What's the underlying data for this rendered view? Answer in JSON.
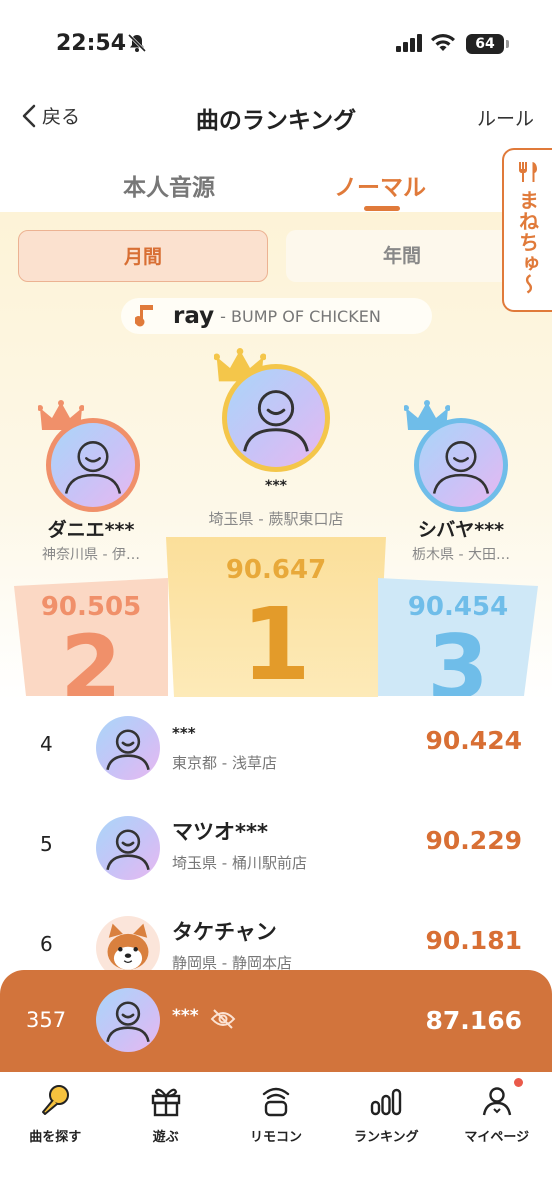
{
  "status": {
    "time": "22:54",
    "battery": "64"
  },
  "header": {
    "back_label": "戻る",
    "title": "曲のランキング",
    "rule_label": "ルール"
  },
  "tabs": {
    "honnin": "本人音源",
    "normal": "ノーマル"
  },
  "side_tab": {
    "label": "まねちゅ〜"
  },
  "period": {
    "month": "月間",
    "year": "年間"
  },
  "song": {
    "title": "ray",
    "artist": "- BUMP OF CHICKEN"
  },
  "podium": {
    "first": {
      "name": "***",
      "location": "埼玉県 - 蕨駅東口店",
      "score": "90.647",
      "rank": "1"
    },
    "second": {
      "name": "ダニエ***",
      "location": "神奈川県 - 伊…",
      "score": "90.505",
      "rank": "2"
    },
    "third": {
      "name": "シバヤ***",
      "location": "栃木県 - 大田…",
      "score": "90.454",
      "rank": "3"
    }
  },
  "list": [
    {
      "rank": "4",
      "name": "***",
      "location": "東京都 - 浅草店",
      "score": "90.424"
    },
    {
      "rank": "5",
      "name": "マツオ***",
      "location": "埼玉県 - 桶川駅前店",
      "score": "90.229"
    },
    {
      "rank": "6",
      "name": "タケチャン",
      "location": "静岡県 - 静岡本店",
      "score": "90.181"
    }
  ],
  "me": {
    "rank": "357",
    "name": "***",
    "score": "87.166"
  },
  "nav": [
    {
      "label": "曲を探す",
      "icon": "microphone-icon"
    },
    {
      "label": "遊ぶ",
      "icon": "gift-icon"
    },
    {
      "label": "リモコン",
      "icon": "remote-icon"
    },
    {
      "label": "ランキング",
      "icon": "ranking-icon"
    },
    {
      "label": "マイページ",
      "icon": "user-icon"
    }
  ],
  "colors": {
    "accent": "#d86f34",
    "gold": "#e8a93a",
    "silver_bronze": "#f0906a",
    "blue": "#6fbde9"
  }
}
